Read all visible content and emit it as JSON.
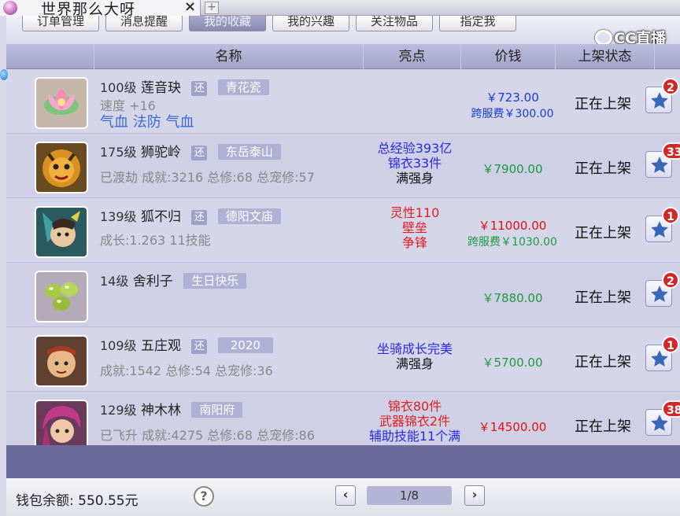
{
  "tab": {
    "title": "世界那么大呀",
    "close": "×",
    "new": "+"
  },
  "topnav": [
    {
      "label": "订单管理",
      "active": false
    },
    {
      "label": "消息提醒",
      "active": false
    },
    {
      "label": "我的收藏",
      "active": true
    },
    {
      "label": "我的兴趣",
      "active": false
    },
    {
      "label": "关注物品",
      "active": false
    },
    {
      "label": "指定我",
      "active": false
    }
  ],
  "watermark": "CC直播",
  "columns": [
    "名称",
    "亮点",
    "价钱",
    "上架状态"
  ],
  "rows": [
    {
      "icon": "lotus-flower-icon",
      "level": "100级",
      "name": "莲音玦",
      "huan": "还",
      "server": "青花瓷",
      "details": [
        {
          "text": "速度 +16",
          "style": "gray"
        },
        {
          "text": "气血 法防 气血",
          "style": "blue"
        }
      ],
      "highlights": [],
      "price": "￥723.00",
      "price_color": "blue",
      "fee": "跨服费￥300.00",
      "status": "正在上架",
      "fav_count": "2"
    },
    {
      "icon": "lion-camel-character-icon",
      "level": "175级",
      "name": "狮驼岭",
      "huan": "还",
      "server": "东岳泰山",
      "details": [
        {
          "text": "已渡劫 成就:3216 总修:68 总宠修:57",
          "style": "gray"
        }
      ],
      "highlights": [
        {
          "text": "总经验393亿",
          "color": "blue"
        },
        {
          "text": "锦衣33件",
          "color": "blue"
        },
        {
          "text": "满强身",
          "color": "black"
        }
      ],
      "price": "￥7900.00",
      "price_color": "green",
      "fee": "",
      "status": "正在上架",
      "fav_count": "33"
    },
    {
      "icon": "fox-warrior-character-icon",
      "level": "139级",
      "name": "狐不归",
      "huan": "还",
      "server": "德阳文庙",
      "details": [
        {
          "text": "成长:1.263 11技能",
          "style": "gray"
        }
      ],
      "highlights": [
        {
          "text": "灵性110",
          "color": "red"
        },
        {
          "text": "壁垒",
          "color": "red"
        },
        {
          "text": "争锋",
          "color": "red"
        }
      ],
      "price": "￥11000.00",
      "price_color": "red",
      "fee": "跨服费￥1030.00",
      "status": "正在上架",
      "fav_count": "1"
    },
    {
      "icon": "sarira-beads-icon",
      "level": "14级",
      "name": "舍利子",
      "huan": "",
      "server": "生日快乐",
      "details": [],
      "highlights": [],
      "price": "￥7880.00",
      "price_color": "green",
      "fee": "",
      "status": "正在上架",
      "fav_count": "2"
    },
    {
      "icon": "wuzhuang-character-icon",
      "level": "109级",
      "name": "五庄观",
      "huan": "还",
      "server": "2020",
      "details": [
        {
          "text": "成就:1542 总修:54 总宠修:36",
          "style": "gray"
        }
      ],
      "highlights": [
        {
          "text": "坐骑成长完美",
          "color": "blue"
        },
        {
          "text": "满强身",
          "color": "black"
        }
      ],
      "price": "￥5700.00",
      "price_color": "green",
      "fee": "",
      "status": "正在上架",
      "fav_count": "1"
    },
    {
      "icon": "shenmulin-character-icon",
      "level": "129级",
      "name": "神木林",
      "huan": "",
      "server": "南阳府",
      "details": [
        {
          "text": "已飞升 成就:4275 总修:68 总宠修:86",
          "style": "gray"
        }
      ],
      "highlights": [
        {
          "text": "锦衣80件",
          "color": "red"
        },
        {
          "text": "武器锦衣2件",
          "color": "red"
        },
        {
          "text": "辅助技能11个满",
          "color": "blue"
        }
      ],
      "price": "￥14500.00",
      "price_color": "red",
      "fee": "",
      "status": "正在上架",
      "fav_count": "38"
    }
  ],
  "footer": {
    "wallet": "钱包余额: 550.55元",
    "help": "?",
    "prev": "‹",
    "next": "›",
    "page": "1/8"
  },
  "colors": {
    "panel": "#7878a8",
    "row_bg": "#d6d6ea",
    "header_bg": "#b0b0d4",
    "badge_red": "#d02828"
  }
}
